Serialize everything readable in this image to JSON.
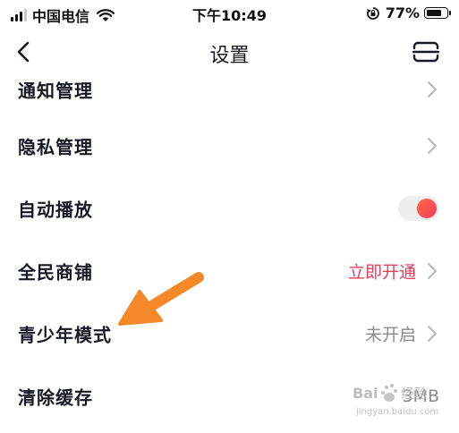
{
  "status_bar": {
    "carrier": "中国电信",
    "time": "下午10:49",
    "battery": "77%",
    "battery_level": 0.77
  },
  "nav": {
    "title": "设置",
    "back_icon": "chevron-left-icon",
    "scan_icon": "scan-icon"
  },
  "settings": {
    "items": [
      {
        "label": "通知管理",
        "value": "",
        "control": "chevron"
      },
      {
        "label": "隐私管理",
        "value": "",
        "control": "chevron"
      },
      {
        "label": "自动播放",
        "value": "",
        "control": "toggle",
        "toggle_on": true
      },
      {
        "label": "全民商铺",
        "value": "立即开通",
        "control": "chevron"
      },
      {
        "label": "青少年模式",
        "value": "未开启",
        "control": "chevron"
      },
      {
        "label": "清除缓存",
        "value": "3MB",
        "control": "none"
      }
    ]
  },
  "colors": {
    "accent": "#e33f5e",
    "muted": "#8a8b91",
    "annotation_arrow": "#f5892a"
  },
  "watermark": {
    "text": "jingyan.baidu.com",
    "logo": "Bai 经验"
  }
}
